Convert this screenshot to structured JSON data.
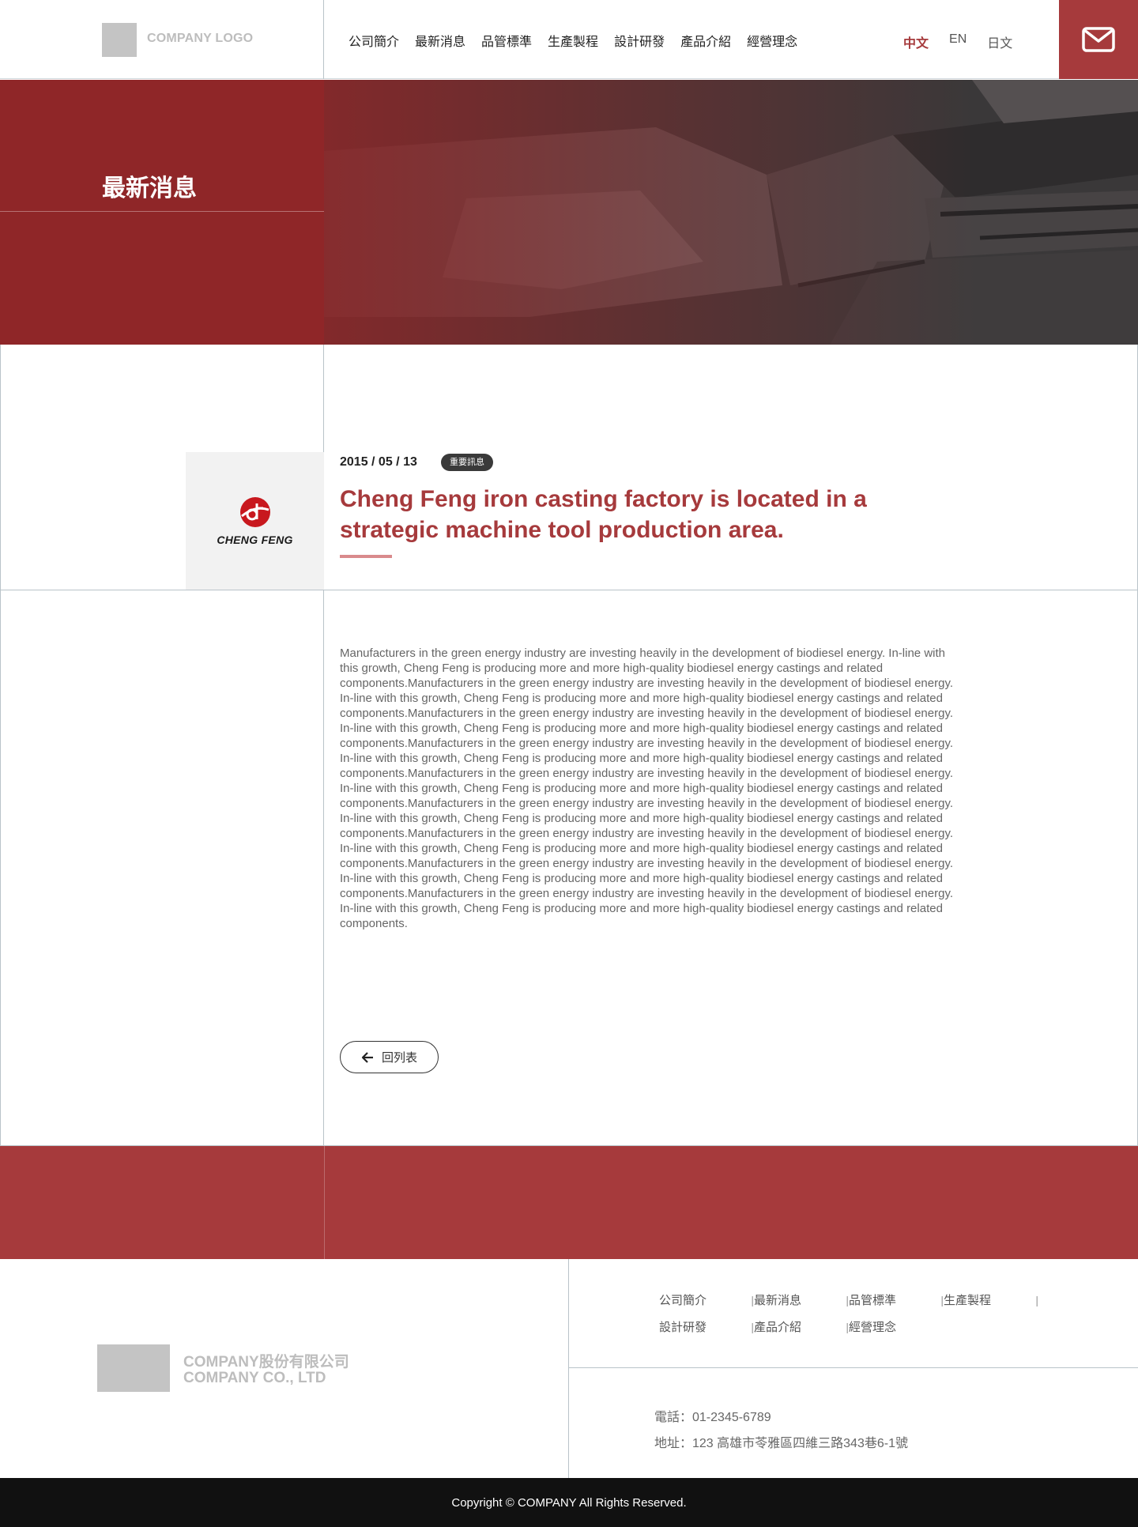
{
  "header": {
    "logo_text": "COMPANY LOGO",
    "nav": [
      "公司簡介",
      "最新消息",
      "品管標準",
      "生產製程",
      "設計研發",
      "產品介紹",
      "經營理念"
    ],
    "languages": [
      "中文",
      "EN",
      "日文"
    ],
    "active_language": "中文",
    "mail_icon": "mail-icon"
  },
  "hero": {
    "title": "最新消息"
  },
  "article": {
    "logo_text": "CHENG FENG",
    "date": "2015 / 05 / 13",
    "badge": "重要訊息",
    "title": "Cheng Feng iron casting factory is located in a strategic machine tool production area.",
    "body": "Manufacturers in the green energy industry are investing heavily in the development of biodiesel energy. In-line with this growth, Cheng Feng is producing more and more high-quality biodiesel energy castings and related  components.Manufacturers in the green energy industry are investing heavily in the development of biodiesel energy. In-line with this growth, Cheng Feng is producing more and more high-quality biodiesel energy castings and related components.Manufacturers in the green energy industry are investing heavily in the development of biodiesel energy. In-line with this growth, Cheng Feng is producing more and more high-quality biodiesel energy castings and related components.Manufacturers in the green energy industry are investing heavily in the development of biodiesel energy. In-line with this growth, Cheng Feng is producing more and more high-quality biodiesel energy castings and related components.Manufacturers in the green energy industry are investing heavily in the development of biodiesel energy. In-line with this growth, Cheng Feng is producing more and more high-quality biodiesel energy castings and related components.Manufacturers in the green energy industry are investing heavily in the development of biodiesel energy. In-line with this growth, Cheng Feng is producing more and more high-quality biodiesel energy castings and related components.Manufacturers in the green energy industry are investing heavily in the development of biodiesel energy. In-line with this growth, Cheng Feng is producing more and more high-quality biodiesel energy castings and related components.Manufacturers in the green energy industry are investing heavily in the development of biodiesel energy. In-line with this growth, Cheng Feng is producing more and more high-quality biodiesel energy castings and related components.Manufacturers in the green energy industry are investing heavily in the development of biodiesel energy. In-line with this growth, Cheng Feng is producing more and more high-quality biodiesel energy castings and related components.",
    "back_label": "回列表"
  },
  "footer": {
    "company_cn": "COMPANY股份有限公司",
    "company_en": "COMPANY CO., LTD",
    "nav": [
      "公司簡介",
      "最新消息",
      "品管標準",
      "生產製程",
      "設計研發",
      "產品介紹",
      "經營理念"
    ],
    "nav_separator": "|",
    "phone": "電話：01-2345-6789",
    "address": "地址：123 高雄市苓雅區四維三路343巷6-1號",
    "copyright": "Copyright © COMPANY All Rights Reserved."
  },
  "colors": {
    "brand_red": "#a63a3c",
    "hero_red": "#8f2628",
    "footer_dark": "#111111"
  }
}
